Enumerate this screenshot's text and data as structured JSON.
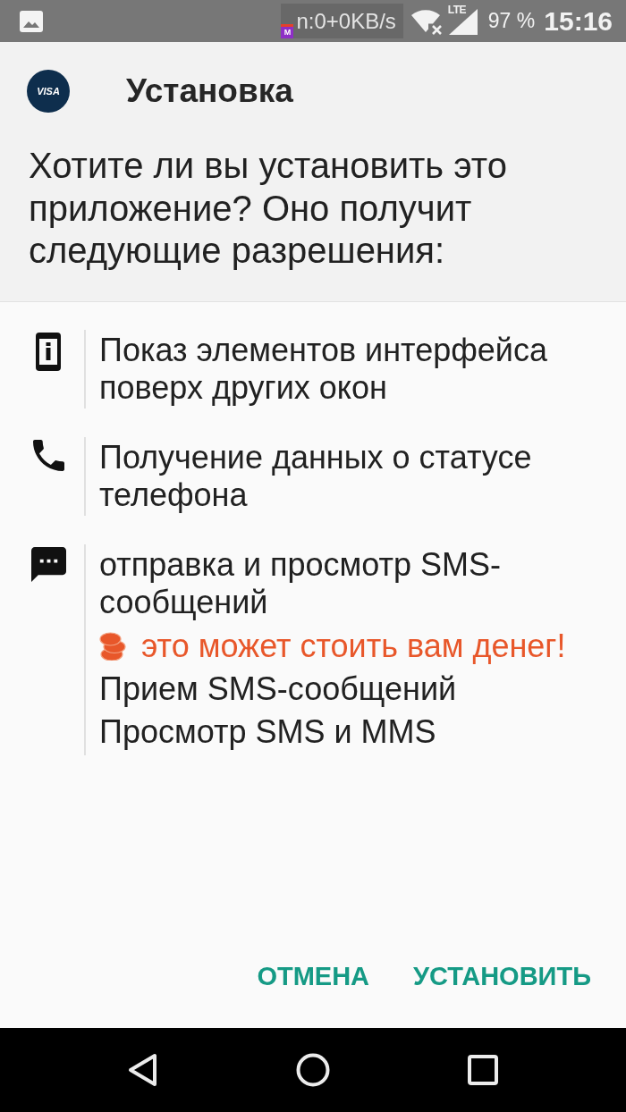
{
  "status_bar": {
    "notification_badge": "M",
    "network_speed": "n:0+0KB/s",
    "network_type": "LTE",
    "battery": "97 %",
    "time": "15:16"
  },
  "header": {
    "app_logo": "VISA",
    "title": "Установка",
    "prompt": "Хотите ли вы установить это приложение? Оно получит следующие разрешения:"
  },
  "permissions": [
    {
      "kind": "display",
      "label": "Показ элементов интерфейса поверх других окон"
    },
    {
      "kind": "phone",
      "label": "Получение данных о статусе телефона"
    },
    {
      "kind": "message",
      "label": "отправка и просмотр SMS-сообщений",
      "warning": "это может стоить вам денег!",
      "details": [
        "Прием SMS-сообщений",
        "Просмотр SMS и MMS"
      ]
    }
  ],
  "buttons": [
    "ОТМЕНА",
    "УСТАНОВИТЬ"
  ]
}
